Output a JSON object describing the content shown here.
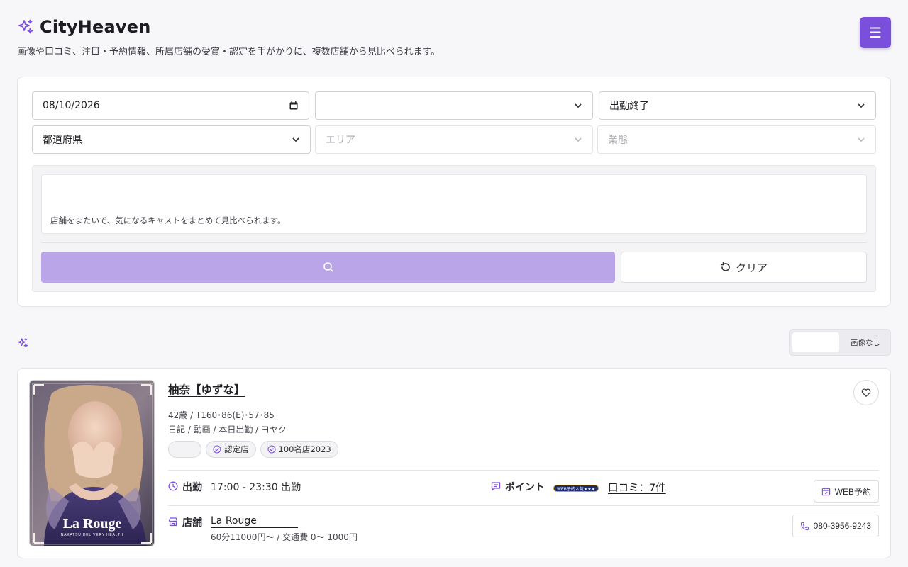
{
  "header": {
    "title": "CityHeaven",
    "tagline": "画像や口コミ、注目・予約情報、所属店舗の受賞・認定を手がかりに、複数店舗から見比べられます。",
    "menu_icon": "☰"
  },
  "search": {
    "date_value": "08/10/2026",
    "time_value": "",
    "status_value": "出勤終了",
    "prefecture_value": "都道府県",
    "area_placeholder": "エリア",
    "type_placeholder": "業態",
    "note": "店舗をまたいで、気になるキャストをまとめて見比べられます。",
    "search_button_label": "",
    "clear_button_label": "クリア"
  },
  "results": {
    "view_toggle": {
      "active_label": "",
      "noimage_label": "画像なし"
    }
  },
  "cast": {
    "name": "柚奈【ゆずな】",
    "stats": "42歳 / T160･86(E)･57･85",
    "subinfo": "日記 / 動画 / 本日出勤 / ヨヤク",
    "tags": [
      {
        "label": ""
      },
      {
        "label": "認定店"
      },
      {
        "label": "100名店2023"
      }
    ],
    "shift_label": "出勤",
    "shift_value": "17:00 - 23:30 出勤",
    "point_label": "ポイント",
    "point_badge": "WEB予約人気★★★",
    "review_link": "口コミ：7件",
    "web_reserve_label": "WEB予約",
    "shop_label": "店舗",
    "shop_name": "La Rouge",
    "price_info": "60分11000円〜 / 交通費 0〜 1000円",
    "phone": "080-3956-9243",
    "photo_logo_text": "La Rouge",
    "photo_logo_sub": "NAKATSU DELIVERY HEALTH"
  },
  "colors": {
    "accent": "#7a4fdc",
    "accent_light": "#b9a5e8"
  }
}
